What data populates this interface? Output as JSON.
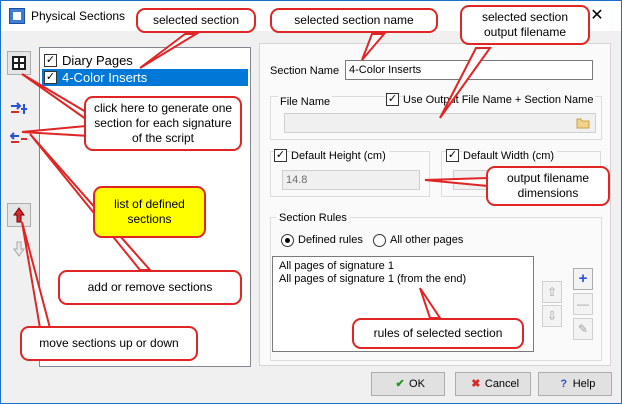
{
  "window": {
    "title": "Physical Sections",
    "close_glyph": "✕"
  },
  "toolbar": {
    "generate_icon": "signature-grid-icon",
    "add_icon": "add-section-icon",
    "remove_icon": "remove-section-icon",
    "up_icon": "arrow-up-icon",
    "down_icon": "arrow-down-icon"
  },
  "sections": [
    {
      "label": "Diary Pages",
      "checked": true,
      "selected": false
    },
    {
      "label": "4-Color Inserts",
      "checked": true,
      "selected": true
    }
  ],
  "section_name": {
    "label": "Section Name",
    "value": "4-Color Inserts"
  },
  "file_name": {
    "label": "File Name",
    "use_output_label": "Use Output File Name + Section Name",
    "value": ""
  },
  "default_height": {
    "label": "Default Height (cm)",
    "value": "14.8"
  },
  "default_width": {
    "label": "Default Width (cm)",
    "value": ""
  },
  "section_rules": {
    "label": "Section Rules",
    "option_defined": "Defined rules",
    "option_other": "All other pages",
    "rules": [
      "All pages of signature 1",
      "All pages of signature 1 (from the end)"
    ]
  },
  "buttons": {
    "ok": "OK",
    "cancel": "Cancel",
    "help": "Help"
  },
  "callouts": {
    "selected_section": "selected section",
    "selected_section_name": "selected section name",
    "selected_output": "selected section output filename",
    "generate": "click here to generate one section for each signature of the script",
    "list": "list of defined sections",
    "dimensions": "output filename dimensions",
    "add_remove": "add or remove sections",
    "rules": "rules of selected section",
    "move": "move sections up or down"
  },
  "colors": {
    "accent": "#0078d7",
    "callout_border": "#e02525",
    "highlight": "#ffff00"
  }
}
